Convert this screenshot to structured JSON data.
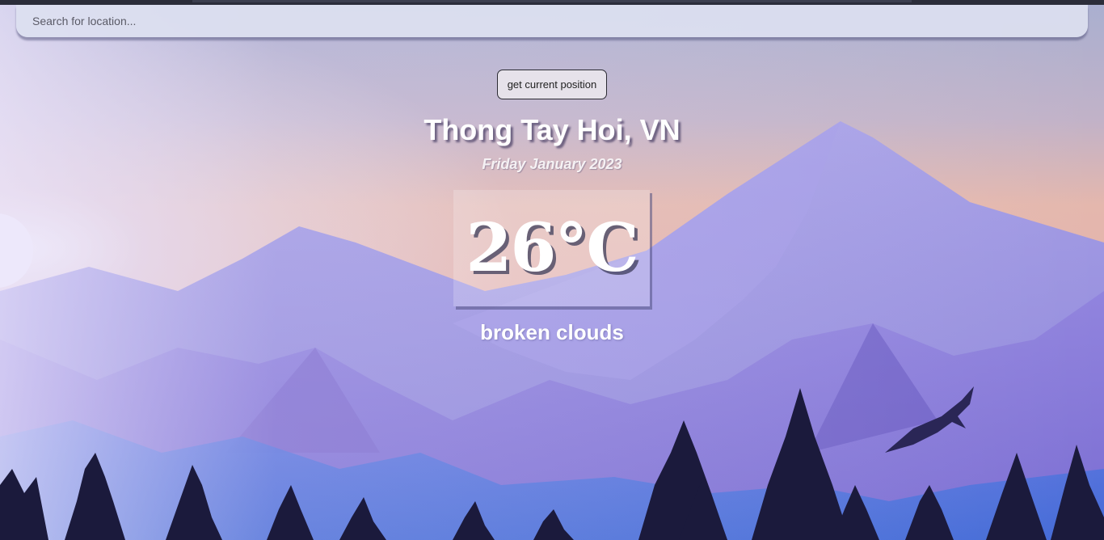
{
  "search": {
    "placeholder": "Search for location..."
  },
  "geo_button": {
    "label": "get current position"
  },
  "weather": {
    "location": "Thong Tay Hoi, VN",
    "date": "Friday January 2023",
    "temperature": "26°C",
    "description": "broken clouds"
  },
  "colors": {
    "sky_top": "#b3b2d0",
    "sky_glow": "#e9b6a6",
    "mountain_far": "#8f85dc",
    "mountain_near": "#7060d0",
    "forest": "#19183a",
    "hill_blue": "#3f6fe0"
  }
}
